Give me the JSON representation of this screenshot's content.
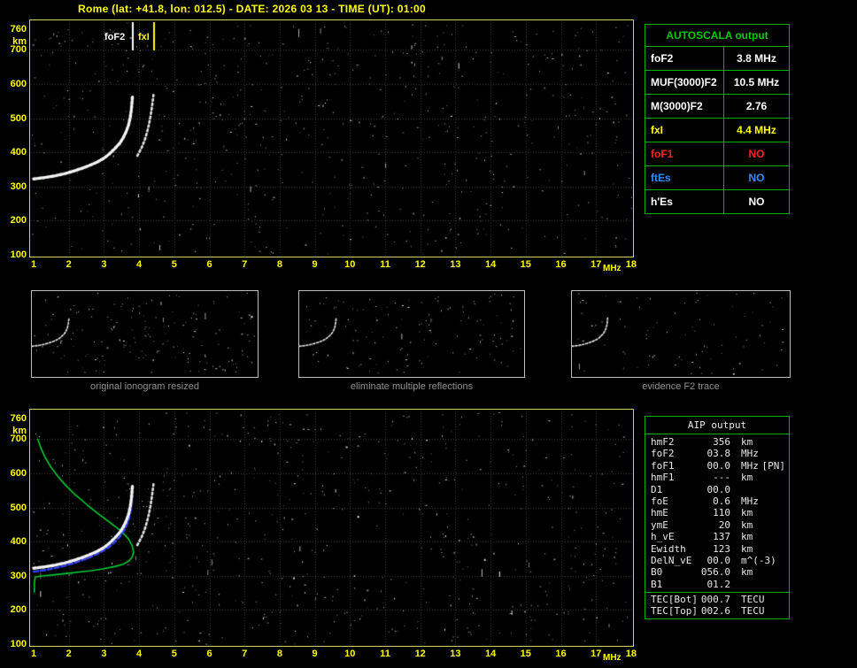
{
  "title": "Rome (lat: +41.8, lon: 012.5) - DATE: 2026 03 13 - TIME (UT): 01:00",
  "top_plot": {
    "foF2_label": "foF2",
    "fxI_label": "fxI"
  },
  "thumbnails": [
    {
      "caption": "original ionogram resized"
    },
    {
      "caption": "eliminate multiple reflections"
    },
    {
      "caption": "evidence F2 trace"
    }
  ],
  "autoscala_table": {
    "title": "AUTOSCALA output",
    "rows": [
      {
        "param": "foF2",
        "value": "3.8 MHz",
        "color": "#ffffff"
      },
      {
        "param": "MUF(3000)F2",
        "value": "10.5 MHz",
        "color": "#ffffff"
      },
      {
        "param": "M(3000)F2",
        "value": "2.76",
        "color": "#ffffff"
      },
      {
        "param": "fxI",
        "value": "4.4 MHz",
        "color": "#ffff00"
      },
      {
        "param": "foF1",
        "value": "NO",
        "color": "#ff2222"
      },
      {
        "param": "ftEs",
        "value": "NO",
        "color": "#2f8fff"
      },
      {
        "param": "h'Es",
        "value": "NO",
        "color": "#ffffff"
      }
    ]
  },
  "aip_table": {
    "title": "AIP output",
    "rows": [
      {
        "param": "hmF2",
        "value": "356",
        "unit": "km"
      },
      {
        "param": "foF2",
        "value": "03.8",
        "unit": "MHz"
      },
      {
        "param": "foF1",
        "value": "00.0",
        "unit": "MHz",
        "note": "[PN]"
      },
      {
        "param": "hmF1",
        "value": "---",
        "unit": "km"
      },
      {
        "param": "D1",
        "value": "00.0",
        "unit": ""
      },
      {
        "param": "foE",
        "value": "0.6",
        "unit": "MHz"
      },
      {
        "param": "hmE",
        "value": "110",
        "unit": "km"
      },
      {
        "param": "ymE",
        "value": "20",
        "unit": "km"
      },
      {
        "param": "h_vE",
        "value": "137",
        "unit": "km"
      },
      {
        "param": "Ewidth",
        "value": "123",
        "unit": "km"
      },
      {
        "param": "DelN_vE",
        "value": "00.0",
        "unit": "m^(-3)"
      },
      {
        "param": "B0",
        "value": "056.0",
        "unit": "km"
      },
      {
        "param": "B1",
        "value": "01.2",
        "unit": ""
      }
    ],
    "tec_rows": [
      {
        "param": "TEC[Bot]",
        "value": "000.7",
        "unit": "TECU"
      },
      {
        "param": "TEC[Top]",
        "value": "002.6",
        "unit": "TECU"
      }
    ]
  },
  "chart_data": {
    "type": "scatter",
    "title": "Ionogram with AUTOSCALA interpretation",
    "x_axis": {
      "label": "MHz",
      "min": 1,
      "max": 18,
      "ticks": [
        "1",
        "2",
        "3",
        "4",
        "5",
        "6",
        "7",
        "8",
        "9",
        "10",
        "11",
        "12",
        "13",
        "14",
        "15",
        "16",
        "17",
        "18"
      ]
    },
    "y_axis": {
      "label": "km",
      "min": 100,
      "max": 760,
      "ticks": [
        "760",
        "700",
        "600",
        "500",
        "400",
        "300",
        "200",
        "100"
      ]
    },
    "foF2_mhz": 3.8,
    "fxI_mhz": 4.4,
    "f2_trace_ordinary": [
      [
        1.0,
        322
      ],
      [
        1.3,
        326
      ],
      [
        1.6,
        331
      ],
      [
        1.9,
        338
      ],
      [
        2.2,
        347
      ],
      [
        2.5,
        358
      ],
      [
        2.8,
        371
      ],
      [
        3.0,
        383
      ],
      [
        3.15,
        395
      ],
      [
        3.3,
        410
      ],
      [
        3.45,
        427
      ],
      [
        3.55,
        443
      ],
      [
        3.63,
        460
      ],
      [
        3.7,
        480
      ],
      [
        3.75,
        503
      ],
      [
        3.78,
        525
      ],
      [
        3.8,
        548
      ],
      [
        3.81,
        562
      ]
    ],
    "f2_trace_extraordinary": [
      [
        3.95,
        390
      ],
      [
        4.08,
        415
      ],
      [
        4.18,
        442
      ],
      [
        4.26,
        472
      ],
      [
        4.32,
        502
      ],
      [
        4.36,
        528
      ],
      [
        4.39,
        552
      ],
      [
        4.41,
        568
      ]
    ],
    "electron_density_profile": [
      [
        1.12,
        700
      ],
      [
        1.2,
        676
      ],
      [
        1.32,
        648
      ],
      [
        1.48,
        620
      ],
      [
        1.68,
        592
      ],
      [
        1.92,
        564
      ],
      [
        2.2,
        536
      ],
      [
        2.52,
        508
      ],
      [
        2.86,
        480
      ],
      [
        3.2,
        454
      ],
      [
        3.5,
        430
      ],
      [
        3.7,
        408
      ],
      [
        3.81,
        386
      ],
      [
        3.84,
        368
      ],
      [
        3.81,
        356
      ],
      [
        3.72,
        344
      ],
      [
        3.55,
        334
      ],
      [
        3.3,
        327
      ],
      [
        3.0,
        321
      ],
      [
        2.65,
        315
      ],
      [
        2.3,
        311
      ],
      [
        1.95,
        307
      ],
      [
        1.6,
        303
      ],
      [
        1.3,
        300
      ],
      [
        1.05,
        297
      ],
      [
        1.02,
        280
      ],
      [
        1.02,
        252
      ]
    ],
    "restored_trace": [
      [
        1.0,
        312
      ],
      [
        1.4,
        318
      ],
      [
        1.8,
        327
      ],
      [
        2.2,
        339
      ],
      [
        2.6,
        354
      ],
      [
        2.9,
        369
      ],
      [
        3.15,
        385
      ],
      [
        3.35,
        403
      ],
      [
        3.5,
        421
      ],
      [
        3.62,
        441
      ],
      [
        3.7,
        463
      ],
      [
        3.76,
        490
      ],
      [
        3.79,
        516
      ],
      [
        3.81,
        542
      ]
    ]
  }
}
